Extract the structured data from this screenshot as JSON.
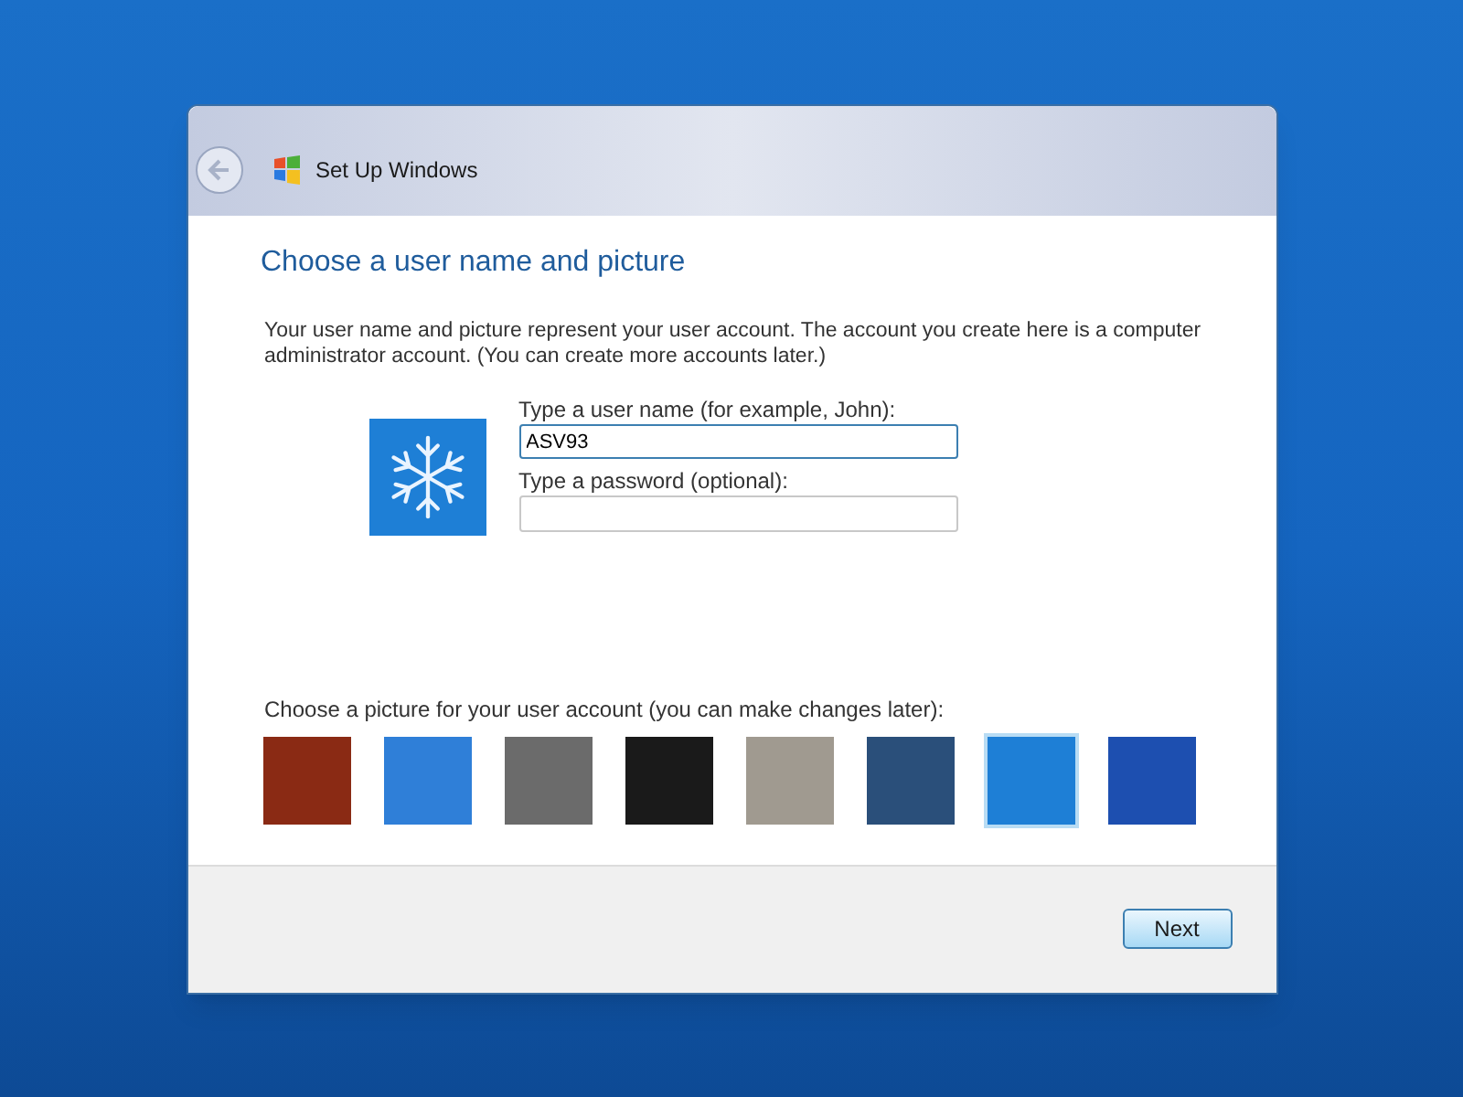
{
  "window": {
    "title": "Set Up Windows"
  },
  "heading": "Choose a user name and picture",
  "intro": "Your user name and picture represent your user account. The account you create here is a computer administrator account. (You can create more accounts later.)",
  "username": {
    "label": "Type a user name (for example, John):",
    "value": "ASV93"
  },
  "password": {
    "label": "Type a password (optional):"
  },
  "pictures_label": "Choose a picture for your user account (you can make changes later):",
  "pictures": [
    {
      "color": "#8a2a14",
      "selected": false
    },
    {
      "color": "#2f7fd8",
      "selected": false
    },
    {
      "color": "#6b6b6b",
      "selected": false
    },
    {
      "color": "#1a1a1a",
      "selected": false
    },
    {
      "color": "#a09a90",
      "selected": false
    },
    {
      "color": "#2a4f7a",
      "selected": false
    },
    {
      "color": "#1e7fd6",
      "selected": true
    },
    {
      "color": "#1d4fb0",
      "selected": false
    }
  ],
  "buttons": [
    {
      "label": "Next"
    }
  ]
}
